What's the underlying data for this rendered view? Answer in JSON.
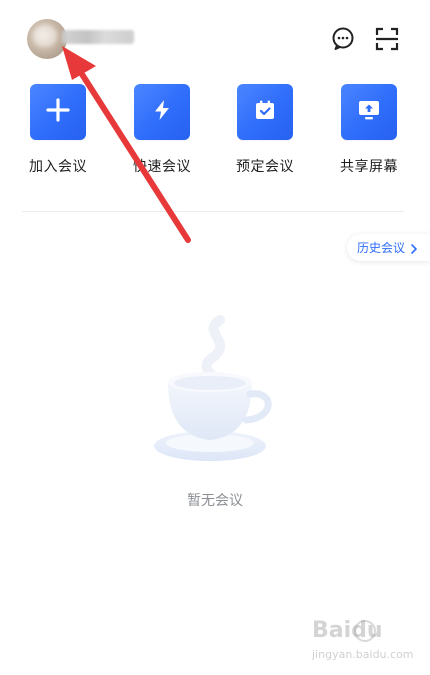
{
  "header": {
    "avatar_icon": "user-avatar",
    "chat_icon": "chat-bubble-icon",
    "scan_icon": "scan-icon"
  },
  "actions": [
    {
      "label": "加入会议",
      "icon": "plus-icon"
    },
    {
      "label": "快速会议",
      "icon": "lightning-icon"
    },
    {
      "label": "预定会议",
      "icon": "calendar-check-icon"
    },
    {
      "label": "共享屏幕",
      "icon": "screen-share-icon"
    }
  ],
  "history_label": "历史会议",
  "empty_text": "暂无会议",
  "watermark": {
    "brand": "Baidu",
    "sub": "jingyan.baidu.com"
  },
  "colors": {
    "accent": "#2f6dfb",
    "arrow": "#e8393a"
  }
}
